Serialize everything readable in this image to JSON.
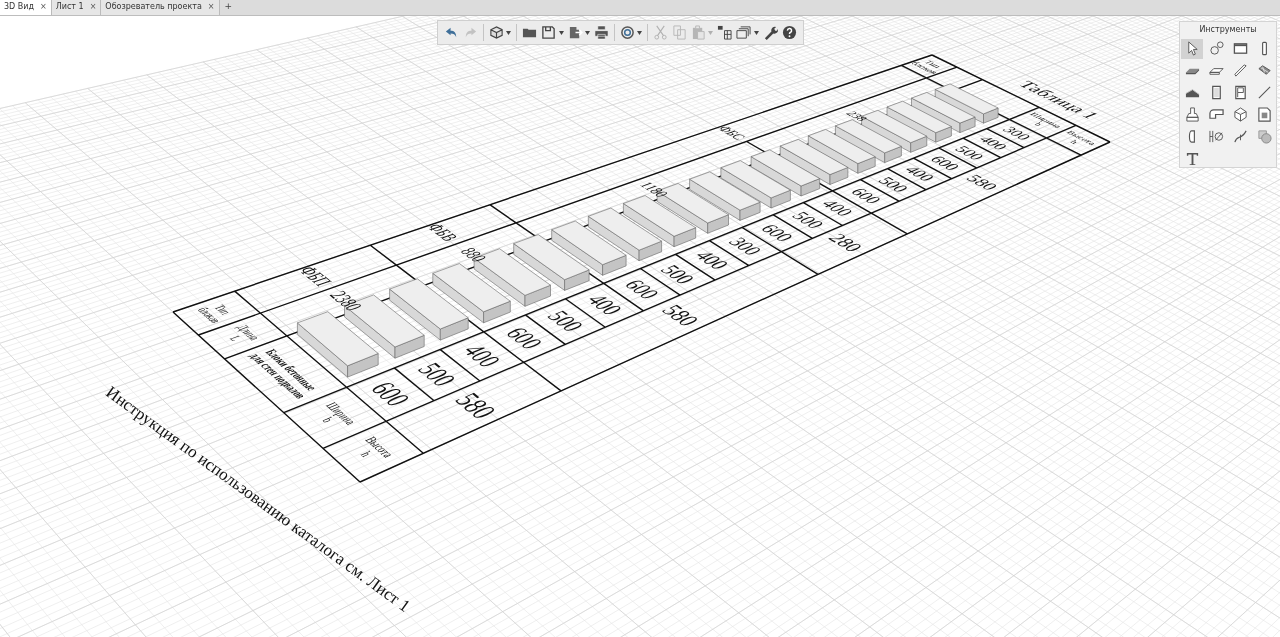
{
  "tabs": [
    {
      "label": "3D Вид",
      "close": "×",
      "selected": true
    },
    {
      "label": "Лист 1",
      "close": "×",
      "selected": false
    },
    {
      "label": "Обозреватель проекта",
      "close": "×",
      "selected": false
    }
  ],
  "add_tab": "+",
  "toolbar": [
    {
      "kind": "undo",
      "disabled": false,
      "dropdown": false
    },
    {
      "kind": "redo",
      "disabled": true,
      "dropdown": false
    },
    {
      "kind": "separator"
    },
    {
      "kind": "cube",
      "disabled": false,
      "dropdown": true
    },
    {
      "kind": "separator"
    },
    {
      "kind": "folder",
      "disabled": false,
      "dropdown": false
    },
    {
      "kind": "save",
      "disabled": false,
      "dropdown": true
    },
    {
      "kind": "export",
      "disabled": false,
      "dropdown": true
    },
    {
      "kind": "print",
      "disabled": false,
      "dropdown": false
    },
    {
      "kind": "separator"
    },
    {
      "kind": "rotate",
      "disabled": false,
      "dropdown": true
    },
    {
      "kind": "separator"
    },
    {
      "kind": "cut",
      "disabled": true,
      "dropdown": false
    },
    {
      "kind": "copy",
      "disabled": true,
      "dropdown": false
    },
    {
      "kind": "paste",
      "disabled": true,
      "dropdown": true
    },
    {
      "kind": "grid",
      "disabled": false,
      "dropdown": false
    },
    {
      "kind": "views",
      "disabled": false,
      "dropdown": true
    },
    {
      "kind": "wrench",
      "disabled": false,
      "dropdown": false
    },
    {
      "kind": "help",
      "disabled": false,
      "dropdown": false
    }
  ],
  "tools_panel": {
    "title": "Инструменты",
    "tools": [
      {
        "kind": "pointer",
        "selected": true
      },
      {
        "kind": "object",
        "selected": false
      },
      {
        "kind": "panel",
        "selected": false
      },
      {
        "kind": "column",
        "selected": false
      },
      {
        "kind": "slab",
        "selected": false
      },
      {
        "kind": "floor",
        "selected": false
      },
      {
        "kind": "beam",
        "selected": false
      },
      {
        "kind": "roof",
        "selected": false
      },
      {
        "kind": "ramp",
        "selected": false
      },
      {
        "kind": "door",
        "selected": false
      },
      {
        "kind": "window",
        "selected": false
      },
      {
        "kind": "line",
        "selected": false
      },
      {
        "kind": "figure",
        "selected": false
      },
      {
        "kind": "pipe",
        "selected": false
      },
      {
        "kind": "polyhedron",
        "selected": false
      },
      {
        "kind": "picture",
        "selected": false
      },
      {
        "kind": "opening",
        "selected": false
      },
      {
        "kind": "dimension",
        "selected": false
      },
      {
        "kind": "spline",
        "selected": false
      },
      {
        "kind": "hatch",
        "selected": false
      },
      {
        "kind": "text",
        "selected": false
      }
    ]
  },
  "table": {
    "title": "Таблица 1",
    "header": {
      "type": "Тип блоков",
      "length": "Длина L",
      "blocks": "Блоки бетонные для стен подвалов",
      "width": "Ширина b",
      "height": "Высота h"
    },
    "right_header": {
      "type": "Тип блоков",
      "width": "Ширина b",
      "height": "Высота h"
    },
    "types": [
      "ФБП",
      "ФБВ",
      "ФБС"
    ],
    "lengths": [
      "2380",
      "880",
      "1180",
      "238"
    ],
    "widths": [
      "600",
      "500",
      "400",
      "600",
      "500",
      "400",
      "600",
      "500",
      "400",
      "300",
      "600",
      "500",
      "400",
      "600",
      "500",
      "400",
      "600",
      "500",
      "400",
      "300"
    ],
    "heights": [
      "580",
      "580",
      "280",
      "580"
    ]
  },
  "note": "Инструкция по использованию каталога см. Лист 1"
}
